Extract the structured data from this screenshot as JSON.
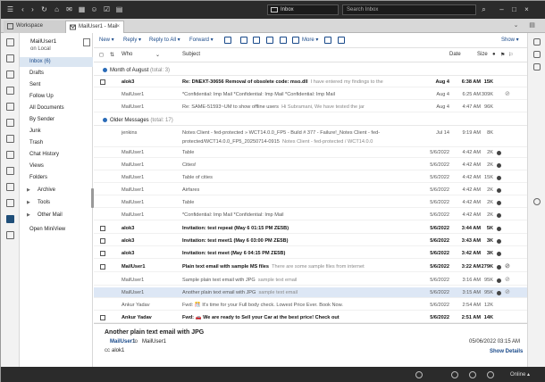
{
  "topbar": {
    "location_label": "Inbox",
    "search_placeholder": "Search Inbox"
  },
  "tabs": [
    {
      "label": "Workspace"
    },
    {
      "label": "MailUser1 - Mail"
    }
  ],
  "navigator": {
    "owner_name": "MailUser1",
    "owner_location": "on Local",
    "items": [
      {
        "label": "Inbox (6)",
        "selected": true
      },
      {
        "label": "Drafts"
      },
      {
        "label": "Sent"
      },
      {
        "label": "Follow Up"
      },
      {
        "label": "All Documents"
      },
      {
        "label": "By Sender"
      },
      {
        "label": "Junk"
      },
      {
        "label": "Trash"
      },
      {
        "label": "Chat History"
      },
      {
        "label": "Views"
      },
      {
        "label": "Folders"
      },
      {
        "label": "Archive",
        "twisty": "▶"
      },
      {
        "label": "Tools",
        "twisty": "▶"
      },
      {
        "label": "Other Mail",
        "twisty": "▶"
      },
      {
        "label": "Open MiniView"
      }
    ]
  },
  "toolbar": {
    "new": "New ▾",
    "reply": "Reply ▾",
    "reply_all": "Reply to All ▾",
    "forward": "Forward ▾",
    "more": "More ▾",
    "show": "Show ▾"
  },
  "columns": {
    "who": "Who",
    "subject": "Subject",
    "date": "Date",
    "size": "Size"
  },
  "groups": [
    {
      "label": "Month of August",
      "total": "(total: 3)"
    },
    {
      "label": "Older Messages",
      "total": "(total: 17)"
    }
  ],
  "messages": [
    {
      "who": "alok3",
      "subject": "Re: DNEXT-30656 Removal of obsolete code: mso.dll",
      "preview": "I have entered my findings to the",
      "date": "Aug 4",
      "time": "6:38 AM",
      "size": "15K",
      "unread": true
    },
    {
      "who": "MailUser1",
      "subject": "*Confidential: Imp Mail *Confidential: Imp Mail *Confidential: Imp Mail",
      "preview": "",
      "date": "Aug 4",
      "time": "6:25 AM",
      "size": "309K",
      "clip": true
    },
    {
      "who": "MailUser1",
      "subject": "Re: SAME-51593~UM to show offline users",
      "preview": "Hi Subramani, We have tested the jar",
      "date": "Aug 4",
      "time": "4:47 AM",
      "size": "96K"
    },
    {
      "who": "jenkins",
      "subject": "Notes Client - fed-protected » WCT14.0.0_FP5 - Build # 377 - Failure!_Notes Client - fed-",
      "preview": "",
      "date": "Jul 14",
      "time": "9:19 AM",
      "size": "8K"
    },
    {
      "who": "",
      "subject": "protected/WCT14.0.0_FP5_20250714-0915",
      "preview": "Notes Client - fed-protected / WCT14.0.0",
      "date": "",
      "time": "",
      "size": ""
    },
    {
      "who": "MailUser1",
      "subject": "Table",
      "preview": "",
      "date": "5/6/2022",
      "time": "4:42 AM",
      "size": "2K",
      "dot": true
    },
    {
      "who": "MailUser1",
      "subject": "Cities!",
      "preview": "",
      "date": "5/6/2022",
      "time": "4:42 AM",
      "size": "2K",
      "dot": true
    },
    {
      "who": "MailUser1",
      "subject": "Table of cities",
      "preview": "",
      "date": "5/6/2022",
      "time": "4:42 AM",
      "size": "15K",
      "dot": true
    },
    {
      "who": "MailUser1",
      "subject": "Airfares",
      "preview": "",
      "date": "5/6/2022",
      "time": "4:42 AM",
      "size": "2K",
      "dot": true
    },
    {
      "who": "MailUser1",
      "subject": "Table",
      "preview": "",
      "date": "5/6/2022",
      "time": "4:42 AM",
      "size": "2K",
      "dot": true
    },
    {
      "who": "MailUser1",
      "subject": "*Confidential: Imp Mail *Confidential: Imp Mail",
      "preview": "",
      "date": "5/6/2022",
      "time": "4:42 AM",
      "size": "2K",
      "dot": true
    },
    {
      "who": "alok3",
      "subject": "Invitation: test repeat (May 6 01:15 PM ZE5B)",
      "preview": "",
      "date": "5/6/2022",
      "time": "3:44 AM",
      "size": "5K",
      "unread": true,
      "dot": true
    },
    {
      "who": "alok3",
      "subject": "Invitation: test meet1 (May 6 03:00 PM ZE5B)",
      "preview": "",
      "date": "5/6/2022",
      "time": "3:43 AM",
      "size": "3K",
      "unread": true,
      "dot": true
    },
    {
      "who": "alok3",
      "subject": "Invitation: test meet (May 6 04:15 PM ZE5B)",
      "preview": "",
      "date": "5/6/2022",
      "time": "3:42 AM",
      "size": "3K",
      "unread": true,
      "dot": true
    },
    {
      "who": "MailUser1",
      "subject": "Plain text email with sample MS files",
      "preview": "There are some sample files from internet",
      "date": "5/6/2022",
      "time": "3:22 AM",
      "size": "279K",
      "unread": true,
      "dot": true,
      "clip": true
    },
    {
      "who": "MailUser1",
      "subject": "Sample plain text email with JPG",
      "preview": "sample text email",
      "date": "5/6/2022",
      "time": "3:16 AM",
      "size": "95K",
      "dot": true,
      "clip": true
    },
    {
      "who": "MailUser1",
      "subject": "Another plain text email with JPG",
      "preview": "sample text email",
      "date": "5/6/2022",
      "time": "3:15 AM",
      "size": "95K",
      "dot": true,
      "clip": true,
      "selected": true
    },
    {
      "who": "Ankur Yadav",
      "subject": "Fwd: 🎊 It's time for your Full body check. Lowest Price Ever. Book Now.",
      "preview": "",
      "date": "5/6/2022",
      "time": "2:54 AM",
      "size": "12K"
    },
    {
      "who": "Ankur Yadav",
      "subject": "Fwd: 🚗 We are ready to Sell your Car at the best price! Check out",
      "preview": "",
      "date": "5/6/2022",
      "time": "2:51 AM",
      "size": "14K",
      "unread": true
    }
  ],
  "preview_pane": {
    "subject": "Another plain text email with JPG",
    "from": "MailUser1",
    "to_label": "to",
    "to_name": "MailUser1",
    "cc_label": "cc",
    "cc_name": "alok1",
    "date": "05/06/2022 03:15 AM",
    "show_details": "Show Details"
  },
  "statusbar": {
    "online_label": "Online ▴"
  },
  "colors": {
    "accent": "#1a4a8a",
    "selected_row": "#dde7f5",
    "dark_chrome": "#2b2b2b"
  }
}
